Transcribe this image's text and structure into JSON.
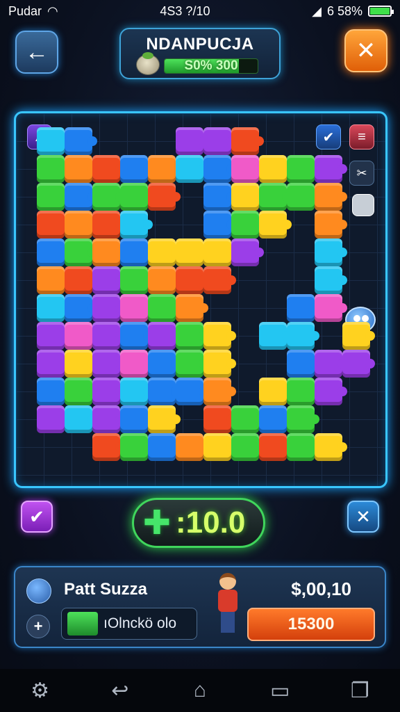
{
  "status_bar": {
    "carrier": "Pudar",
    "clock": "4S3 ?/10",
    "battery_text": "6 58%"
  },
  "header": {
    "title": "NDANPUCJA",
    "score_text": "S0% 300",
    "score_fill_percent": 80
  },
  "board": {
    "colors": {
      "red": "#f04a1f",
      "orange": "#ff8a1f",
      "yellow": "#ffd21f",
      "green": "#39d13b",
      "blue": "#1f7ff0",
      "cyan": "#23c6f2",
      "purple": "#9b3ee8",
      "pink": "#f05ac8"
    },
    "pieces": [
      [
        "cyan",
        1,
        1
      ],
      [
        "blue",
        2,
        1
      ],
      [
        "purple",
        6,
        1
      ],
      [
        "purple",
        7,
        1
      ],
      [
        "red",
        8,
        1
      ],
      [
        "green",
        1,
        2
      ],
      [
        "orange",
        2,
        2
      ],
      [
        "red",
        3,
        2
      ],
      [
        "blue",
        4,
        2
      ],
      [
        "orange",
        5,
        2
      ],
      [
        "cyan",
        6,
        2
      ],
      [
        "blue",
        7,
        2
      ],
      [
        "pink",
        8,
        2
      ],
      [
        "yellow",
        9,
        2
      ],
      [
        "green",
        10,
        2
      ],
      [
        "purple",
        11,
        2
      ],
      [
        "green",
        1,
        3
      ],
      [
        "blue",
        2,
        3
      ],
      [
        "green",
        3,
        3
      ],
      [
        "green",
        4,
        3
      ],
      [
        "red",
        5,
        3
      ],
      [
        "blue",
        7,
        3
      ],
      [
        "yellow",
        8,
        3
      ],
      [
        "green",
        9,
        3
      ],
      [
        "green",
        10,
        3
      ],
      [
        "orange",
        11,
        3
      ],
      [
        "red",
        1,
        4
      ],
      [
        "orange",
        2,
        4
      ],
      [
        "red",
        3,
        4
      ],
      [
        "cyan",
        4,
        4
      ],
      [
        "blue",
        7,
        4
      ],
      [
        "green",
        8,
        4
      ],
      [
        "yellow",
        9,
        4
      ],
      [
        "orange",
        11,
        4
      ],
      [
        "blue",
        1,
        5
      ],
      [
        "green",
        2,
        5
      ],
      [
        "orange",
        3,
        5
      ],
      [
        "blue",
        4,
        5
      ],
      [
        "yellow",
        5,
        5
      ],
      [
        "yellow",
        6,
        5
      ],
      [
        "yellow",
        7,
        5
      ],
      [
        "purple",
        8,
        5
      ],
      [
        "cyan",
        11,
        5
      ],
      [
        "orange",
        1,
        6
      ],
      [
        "red",
        2,
        6
      ],
      [
        "purple",
        3,
        6
      ],
      [
        "green",
        4,
        6
      ],
      [
        "orange",
        5,
        6
      ],
      [
        "red",
        6,
        6
      ],
      [
        "red",
        7,
        6
      ],
      [
        "cyan",
        11,
        6
      ],
      [
        "cyan",
        1,
        7
      ],
      [
        "blue",
        2,
        7
      ],
      [
        "purple",
        3,
        7
      ],
      [
        "pink",
        4,
        7
      ],
      [
        "green",
        5,
        7
      ],
      [
        "orange",
        6,
        7
      ],
      [
        "blue",
        10,
        7
      ],
      [
        "pink",
        11,
        7
      ],
      [
        "purple",
        1,
        8
      ],
      [
        "pink",
        2,
        8
      ],
      [
        "purple",
        3,
        8
      ],
      [
        "blue",
        4,
        8
      ],
      [
        "purple",
        5,
        8
      ],
      [
        "green",
        6,
        8
      ],
      [
        "yellow",
        7,
        8
      ],
      [
        "cyan",
        9,
        8
      ],
      [
        "cyan",
        10,
        8
      ],
      [
        "yellow",
        12,
        8
      ],
      [
        "purple",
        1,
        9
      ],
      [
        "yellow",
        2,
        9
      ],
      [
        "purple",
        3,
        9
      ],
      [
        "pink",
        4,
        9
      ],
      [
        "blue",
        5,
        9
      ],
      [
        "green",
        6,
        9
      ],
      [
        "yellow",
        7,
        9
      ],
      [
        "blue",
        10,
        9
      ],
      [
        "purple",
        11,
        9
      ],
      [
        "purple",
        12,
        9
      ],
      [
        "blue",
        1,
        10
      ],
      [
        "green",
        2,
        10
      ],
      [
        "purple",
        3,
        10
      ],
      [
        "cyan",
        4,
        10
      ],
      [
        "blue",
        5,
        10
      ],
      [
        "blue",
        6,
        10
      ],
      [
        "orange",
        7,
        10
      ],
      [
        "yellow",
        9,
        10
      ],
      [
        "green",
        10,
        10
      ],
      [
        "purple",
        11,
        10
      ],
      [
        "purple",
        1,
        11
      ],
      [
        "cyan",
        2,
        11
      ],
      [
        "purple",
        3,
        11
      ],
      [
        "blue",
        4,
        11
      ],
      [
        "yellow",
        5,
        11
      ],
      [
        "red",
        7,
        11
      ],
      [
        "green",
        8,
        11
      ],
      [
        "blue",
        9,
        11
      ],
      [
        "green",
        10,
        11
      ],
      [
        "red",
        3,
        12
      ],
      [
        "green",
        4,
        12
      ],
      [
        "blue",
        5,
        12
      ],
      [
        "orange",
        6,
        12
      ],
      [
        "yellow",
        7,
        12
      ],
      [
        "green",
        8,
        12
      ],
      [
        "red",
        9,
        12
      ],
      [
        "green",
        10,
        12
      ],
      [
        "yellow",
        11,
        12
      ]
    ]
  },
  "controls": {
    "counter_value": ":10.0"
  },
  "bottom_panel": {
    "player_name": "Patt Suzza",
    "money": "$,00,10",
    "progress_text": "ıOlnckö olo",
    "buy_label": "15300"
  }
}
